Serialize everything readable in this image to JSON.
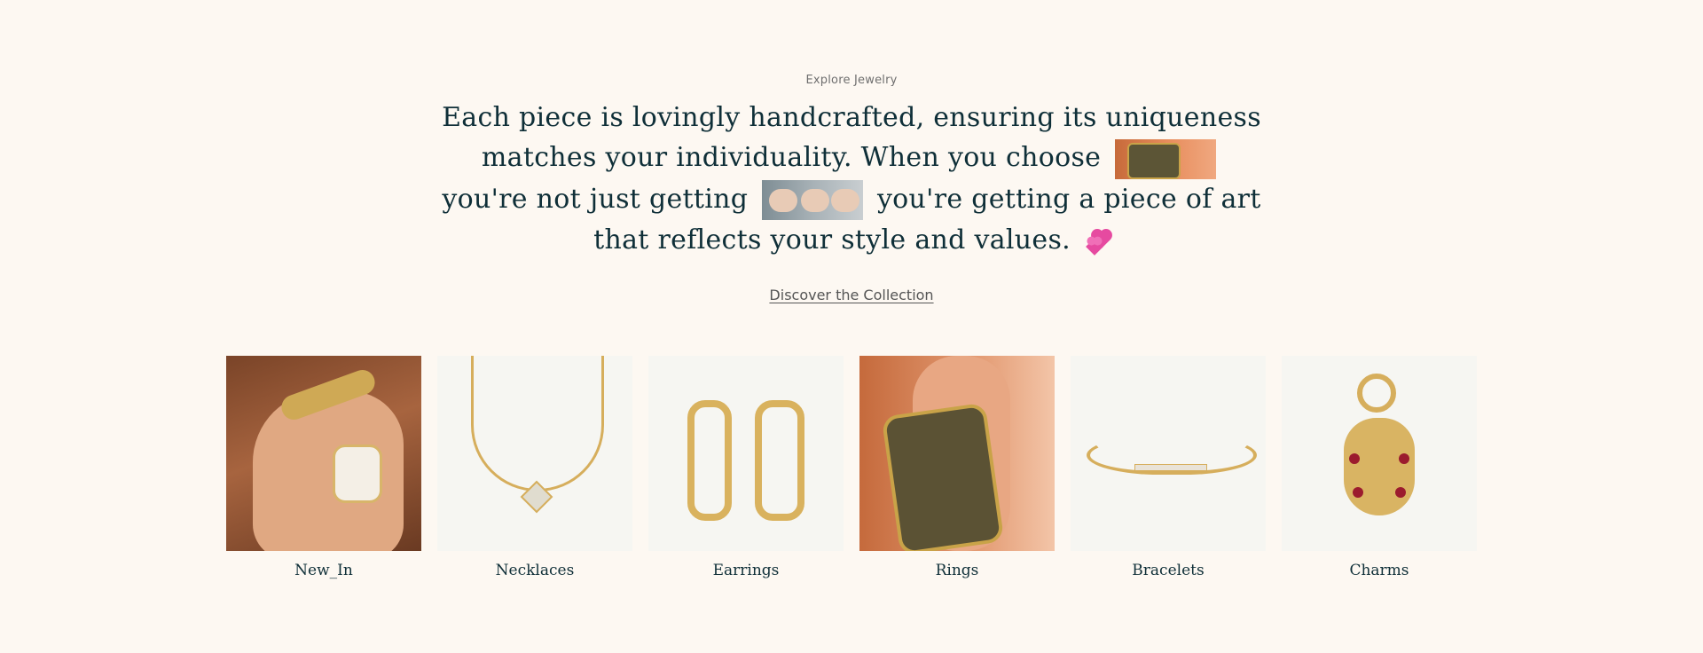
{
  "intro": {
    "eyebrow": "Explore Jewelry",
    "headline_part1": "Each piece is lovingly handcrafted, ensuring its uniqueness matches your individuality. When you choose",
    "headline_part2": "you're not just getting",
    "headline_part3": "you're getting a piece of art that reflects your style and values.",
    "cta_label": "Discover the Collection"
  },
  "categories": [
    {
      "label": "New_In"
    },
    {
      "label": "Necklaces"
    },
    {
      "label": "Earrings"
    },
    {
      "label": "Rings"
    },
    {
      "label": "Bracelets"
    },
    {
      "label": "Charms"
    }
  ],
  "colors": {
    "background": "#fdf8f2",
    "heading": "#0f2f38",
    "accent_gold": "#d6ae5c",
    "heart": "#e64aa0"
  },
  "icons": {
    "inline_emoji": "two-hearts-icon"
  }
}
